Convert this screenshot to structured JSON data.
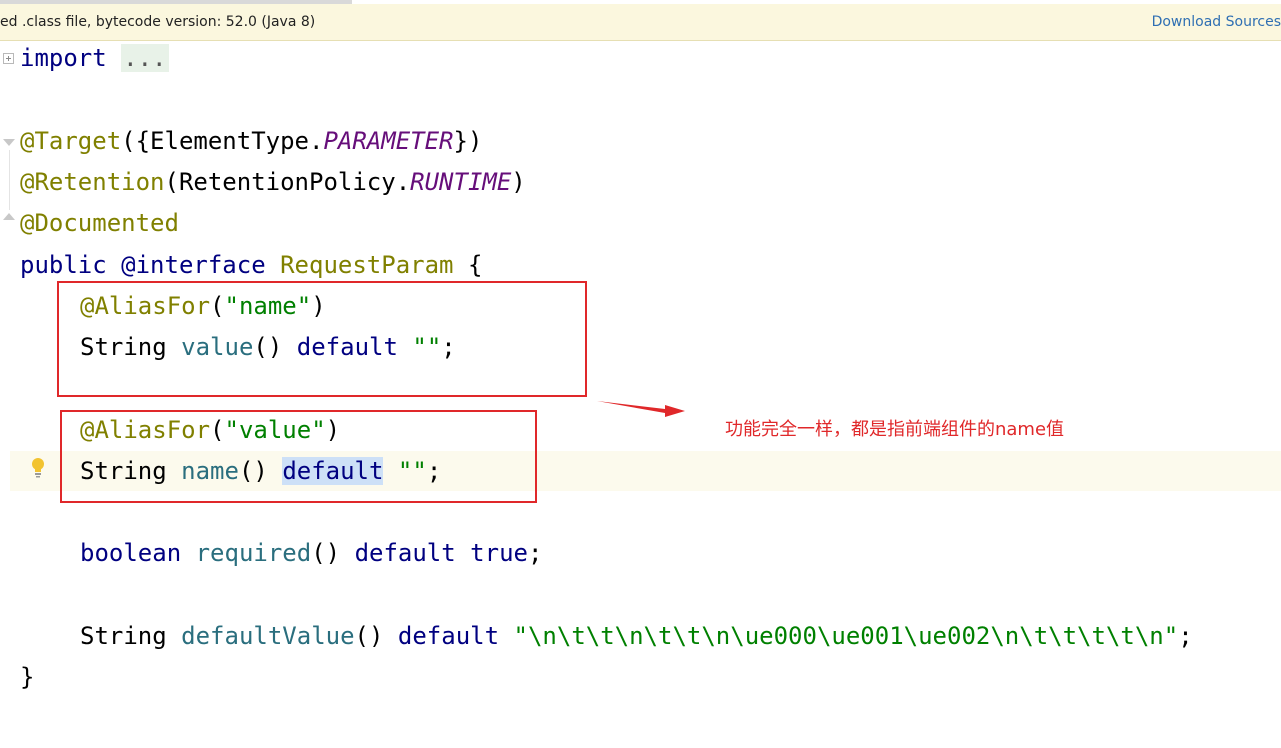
{
  "banner": {
    "message": "ed .class file, bytecode version: 52.0 (Java 8)",
    "link": "Download Sources"
  },
  "code": {
    "import_kw": "import",
    "import_dots": "...",
    "target_ann": "@Target",
    "target_open": "({ElementType.",
    "target_field": "PARAMETER",
    "target_close": "})",
    "retention_ann": "@Retention",
    "retention_open": "(RetentionPolicy.",
    "retention_field": "RUNTIME",
    "retention_close": ")",
    "documented_ann": "@Documented",
    "decl_public": "public",
    "decl_interface": "@interface",
    "decl_name": "RequestParam",
    "decl_brace": "{",
    "alias1_ann": "@AliasFor",
    "alias1_open": "(",
    "alias1_str": "\"name\"",
    "alias1_close": ")",
    "value_type": "String",
    "value_method": "value",
    "value_parens": "()",
    "value_default": "default",
    "value_str": "\"\"",
    "value_semi": ";",
    "alias2_ann": "@AliasFor",
    "alias2_open": "(",
    "alias2_str": "\"value\"",
    "alias2_close": ")",
    "name_type": "String",
    "name_method": "name",
    "name_parens": "()",
    "name_default": "default",
    "name_str": "\"\"",
    "name_semi": ";",
    "req_type": "boolean",
    "req_method": "required",
    "req_parens": "()",
    "req_default": "default",
    "req_true": "true",
    "req_semi": ";",
    "dv_type": "String",
    "dv_method": "defaultValue",
    "dv_parens": "()",
    "dv_default": "default",
    "dv_str": "\"\\n\\t\\t\\n\\t\\t\\n\\ue000\\ue001\\ue002\\n\\t\\t\\t\\t\\n\"",
    "dv_semi": ";",
    "close_brace": "}"
  },
  "annotation": {
    "callout": "功能完全一样，都是指前端组件的name值"
  },
  "colors": {
    "keyword": "#000080",
    "annotation": "#808000",
    "string": "#008000",
    "field": "#660e7a",
    "method": "#2a6e7e",
    "highlight_box": "#e0282a"
  }
}
